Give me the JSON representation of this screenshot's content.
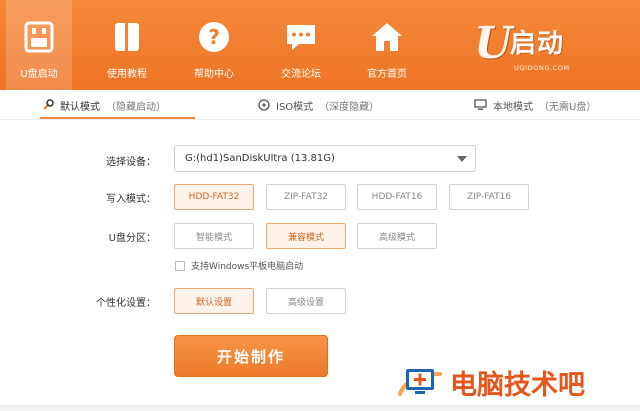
{
  "nav": {
    "items": [
      {
        "label": "U盘启动",
        "icon": "usb-drive-icon",
        "active": true
      },
      {
        "label": "使用教程",
        "icon": "book-icon",
        "active": false
      },
      {
        "label": "帮助中心",
        "icon": "help-icon",
        "active": false
      },
      {
        "label": "交流论坛",
        "icon": "chat-icon",
        "active": false
      },
      {
        "label": "官方首页",
        "icon": "home-icon",
        "active": false
      }
    ]
  },
  "brand": {
    "letter": "U",
    "name": "启动",
    "url": "UQIDONG.COM"
  },
  "mode_tabs": [
    {
      "label": "默认模式",
      "hint": "（隐藏启动）",
      "icon": "wrench-icon",
      "active": true
    },
    {
      "label": "ISO模式",
      "hint": "（深度隐藏）",
      "icon": "disc-icon",
      "active": false
    },
    {
      "label": "本地模式",
      "hint": "（无需U盘）",
      "icon": "monitor-icon",
      "active": false
    }
  ],
  "form": {
    "device_label": "选择设备：",
    "device_value": "G:(hd1)SanDiskUltra (13.81G)",
    "write_label": "写入模式：",
    "write_options": [
      "HDD-FAT32",
      "ZIP-FAT32",
      "HDD-FAT16",
      "ZIP-FAT16"
    ],
    "write_selected": 0,
    "partition_label": "U盘分区：",
    "partition_options": [
      "智能模式",
      "兼容模式",
      "高级模式"
    ],
    "partition_selected": 1,
    "checkbox_label": "支持Windows平板电脑启动",
    "checkbox_checked": false,
    "personal_label": "个性化设置：",
    "personal_options": [
      "默认设置",
      "高级设置"
    ],
    "personal_selected": 0,
    "start_label": "开始制作"
  },
  "watermark": {
    "text": "电脑技术吧"
  },
  "colors": {
    "header": "#f08033",
    "accent": "#ee7a2b",
    "watermark": "#e6561c"
  }
}
